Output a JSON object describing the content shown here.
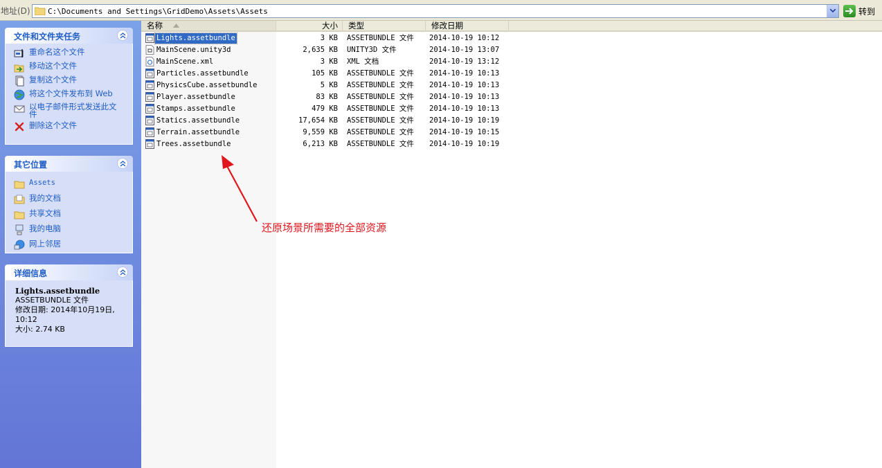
{
  "address": {
    "label": "地址(D)",
    "path": "C:\\Documents and Settings\\GridDemo\\Assets\\Assets",
    "go_label": "转到"
  },
  "tasks_panel": {
    "title": "文件和文件夹任务",
    "items": [
      {
        "label": "重命名这个文件",
        "icon": "rename-icon"
      },
      {
        "label": "移动这个文件",
        "icon": "move-icon"
      },
      {
        "label": "复制这个文件",
        "icon": "copy-icon"
      },
      {
        "label": "将这个文件发布到 Web",
        "icon": "publish-web-icon"
      },
      {
        "label": "以电子邮件形式发送此文件",
        "icon": "email-icon"
      },
      {
        "label": "删除这个文件",
        "icon": "delete-icon"
      }
    ]
  },
  "places_panel": {
    "title": "其它位置",
    "items": [
      {
        "label": "Assets",
        "icon": "folder-icon"
      },
      {
        "label": "我的文档",
        "icon": "my-documents-icon"
      },
      {
        "label": "共享文档",
        "icon": "shared-folder-icon"
      },
      {
        "label": "我的电脑",
        "icon": "my-computer-icon"
      },
      {
        "label": "网上邻居",
        "icon": "network-icon"
      }
    ]
  },
  "details_panel": {
    "title": "详细信息",
    "name": "Lights.assetbundle",
    "type": "ASSETBUNDLE 文件",
    "modified_line1": "修改日期: 2014年10月19日,",
    "modified_line2": "10:12",
    "size": "大小: 2.74 KB"
  },
  "columns": {
    "name": "名称",
    "size": "大小",
    "type": "类型",
    "date": "修改日期"
  },
  "files": [
    {
      "name": "Lights.assetbundle",
      "size": "3 KB",
      "type": "ASSETBUNDLE 文件",
      "date": "2014-10-19 10:12",
      "selected": true,
      "icon": "assetbundle-file-icon"
    },
    {
      "name": "MainScene.unity3d",
      "size": "2,635 KB",
      "type": "UNITY3D 文件",
      "date": "2014-10-19 13:07",
      "icon": "unity3d-file-icon"
    },
    {
      "name": "MainScene.xml",
      "size": "3 KB",
      "type": "XML 文档",
      "date": "2014-10-19 13:12",
      "icon": "xml-file-icon"
    },
    {
      "name": "Particles.assetbundle",
      "size": "105 KB",
      "type": "ASSETBUNDLE 文件",
      "date": "2014-10-19 10:13",
      "icon": "assetbundle-file-icon"
    },
    {
      "name": "PhysicsCube.assetbundle",
      "size": "5 KB",
      "type": "ASSETBUNDLE 文件",
      "date": "2014-10-19 10:13",
      "icon": "assetbundle-file-icon"
    },
    {
      "name": "Player.assetbundle",
      "size": "83 KB",
      "type": "ASSETBUNDLE 文件",
      "date": "2014-10-19 10:13",
      "icon": "assetbundle-file-icon"
    },
    {
      "name": "Stamps.assetbundle",
      "size": "479 KB",
      "type": "ASSETBUNDLE 文件",
      "date": "2014-10-19 10:13",
      "icon": "assetbundle-file-icon"
    },
    {
      "name": "Statics.assetbundle",
      "size": "17,654 KB",
      "type": "ASSETBUNDLE 文件",
      "date": "2014-10-19 10:19",
      "icon": "assetbundle-file-icon"
    },
    {
      "name": "Terrain.assetbundle",
      "size": "9,559 KB",
      "type": "ASSETBUNDLE 文件",
      "date": "2014-10-19 10:15",
      "icon": "assetbundle-file-icon"
    },
    {
      "name": "Trees.assetbundle",
      "size": "6,213 KB",
      "type": "ASSETBUNDLE 文件",
      "date": "2014-10-19 10:19",
      "icon": "assetbundle-file-icon"
    }
  ],
  "annotation": {
    "text": "还原场景所需要的全部资源",
    "color": "#e0161c"
  },
  "colors": {
    "link": "#215dc6",
    "selection": "#316ac5",
    "pane_top": "#7ba2e7",
    "pane_bottom": "#6375d6"
  }
}
